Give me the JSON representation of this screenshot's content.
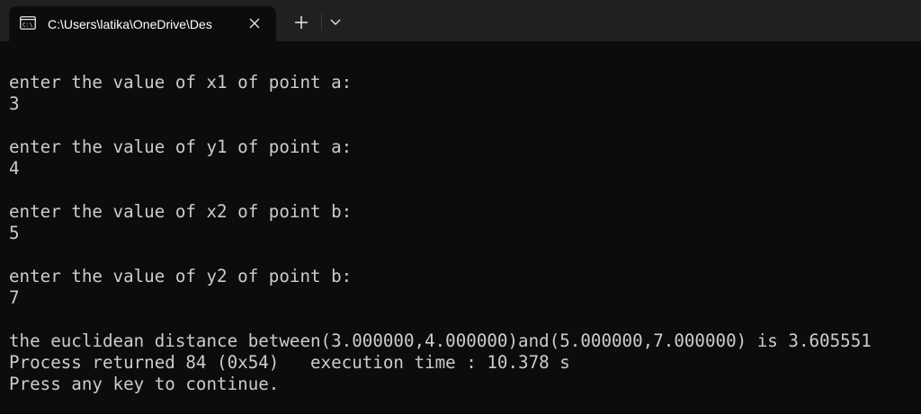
{
  "tab": {
    "title": "C:\\Users\\latika\\OneDrive\\Des",
    "icon": "terminal-icon",
    "close_icon": "close-icon"
  },
  "toolbar": {
    "new_tab_icon": "plus-icon",
    "dropdown_icon": "chevron-down-icon"
  },
  "colors": {
    "background": "#0c0c0c",
    "tabbar": "#202020",
    "text": "#cccccc"
  },
  "console": {
    "lines": [
      "enter the value of x1 of point a:",
      "3",
      "",
      "enter the value of y1 of point a:",
      "4",
      "",
      "enter the value of x2 of point b:",
      "5",
      "",
      "enter the value of y2 of point b:",
      "7",
      "",
      "the euclidean distance between(3.000000,4.000000)and(5.000000,7.000000) is 3.605551",
      "Process returned 84 (0x54)   execution time : 10.378 s",
      "Press any key to continue."
    ]
  }
}
